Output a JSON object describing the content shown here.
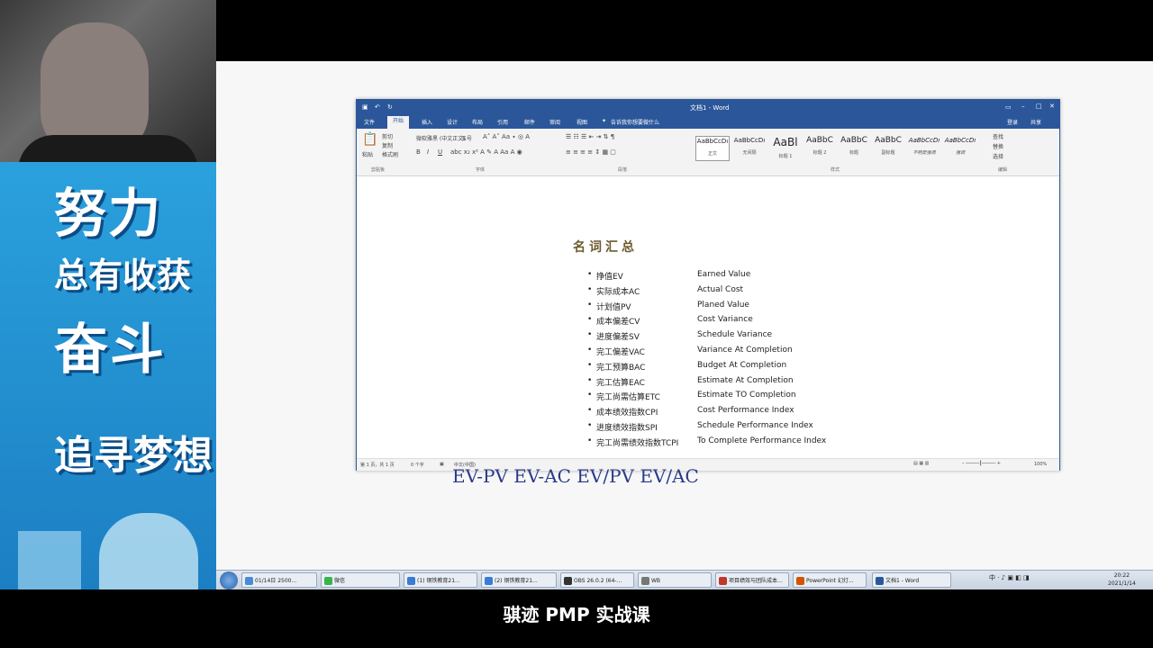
{
  "overlay": {
    "banner_line1": "努力",
    "banner_line2": "总有收获",
    "banner_line3": "奋斗",
    "banner_line4": "追寻梦想"
  },
  "word": {
    "title": "文档1 - Word",
    "tabs": [
      "文件",
      "开始",
      "插入",
      "设计",
      "布局",
      "引用",
      "邮件",
      "审阅",
      "视图"
    ],
    "tell_me": "告诉我你想要做什么",
    "user": "登录",
    "share": "共享",
    "clipboard": {
      "paste": "粘贴",
      "cut": "剪切",
      "copy": "复制",
      "format_painter": "格式刷",
      "label": "剪贴板"
    },
    "font_group": {
      "font": "微软雅黑 (中文正文)",
      "size": "五号",
      "label": "字体"
    },
    "paragraph_label": "段落",
    "styles_label": "样式",
    "editing": {
      "find": "查找",
      "replace": "替换",
      "select": "选择",
      "label": "编辑"
    },
    "styles": [
      {
        "sample": "AaBbCcDı",
        "name": "正文"
      },
      {
        "sample": "AaBbCcDı",
        "name": "无间隔"
      },
      {
        "sample": "AaBl",
        "name": "标题 1"
      },
      {
        "sample": "AaBbC",
        "name": "标题 2"
      },
      {
        "sample": "AaBbC",
        "name": "标题"
      },
      {
        "sample": "AaBbC",
        "name": "副标题"
      },
      {
        "sample": "AaBbCcDı",
        "name": "不明显强调"
      },
      {
        "sample": "AaBbCcDı",
        "name": "强调"
      }
    ],
    "status": {
      "page": "第 1 页，共 1 页",
      "words": "0 个字",
      "lang": "中文(中国)",
      "zoom": "100%"
    },
    "document": {
      "heading": "名词汇总",
      "terms": [
        {
          "zh": "挣值EV",
          "en": "Earned Value"
        },
        {
          "zh": "实际成本AC",
          "en": "Actual Cost"
        },
        {
          "zh": "计划值PV",
          "en": "Planed Value"
        },
        {
          "zh": "成本偏差CV",
          "en": "Cost Variance"
        },
        {
          "zh": "进度偏差SV",
          "en": "Schedule Variance"
        },
        {
          "zh": "完工偏差VAC",
          "en": "Variance At Completion"
        },
        {
          "zh": "完工预算BAC",
          "en": "Budget At Completion"
        },
        {
          "zh": "完工估算EAC",
          "en": "Estimate At Completion"
        },
        {
          "zh": "完工尚需估算ETC",
          "en": "Estimate TO Completion"
        },
        {
          "zh": "成本绩效指数CPI",
          "en": "Cost Performance Index"
        },
        {
          "zh": "进度绩效指数SPI",
          "en": "Schedule Performance Index"
        },
        {
          "zh": "完工尚需绩效指数TCPI",
          "en": "To Complete Performance Index"
        }
      ]
    }
  },
  "handwriting": "EV-PV EV-AC  EV/PV EV/AC",
  "taskbar": {
    "items": [
      {
        "label": "01/14日 2500...",
        "color": "#4a8bd6"
      },
      {
        "label": "微信",
        "color": "#3bb34a"
      },
      {
        "label": "(1) 钢铁教育21...",
        "color": "#3a7bd5"
      },
      {
        "label": "(2) 钢铁教育21...",
        "color": "#3a7bd5"
      },
      {
        "label": "OBS 26.0.2 (64-...",
        "color": "#333333"
      },
      {
        "label": "WB",
        "color": "#777777"
      },
      {
        "label": "项目绩效与团队成本...",
        "color": "#c0392b"
      },
      {
        "label": "PowerPoint 幻灯...",
        "color": "#d35400"
      },
      {
        "label": "文档1 - Word",
        "color": "#2b579a"
      }
    ],
    "tray": "中 · ♪ ▣ ◧ ◨",
    "time": "20:22",
    "date": "2021/1/14"
  },
  "caption": "骐迹 PMP 实战课"
}
